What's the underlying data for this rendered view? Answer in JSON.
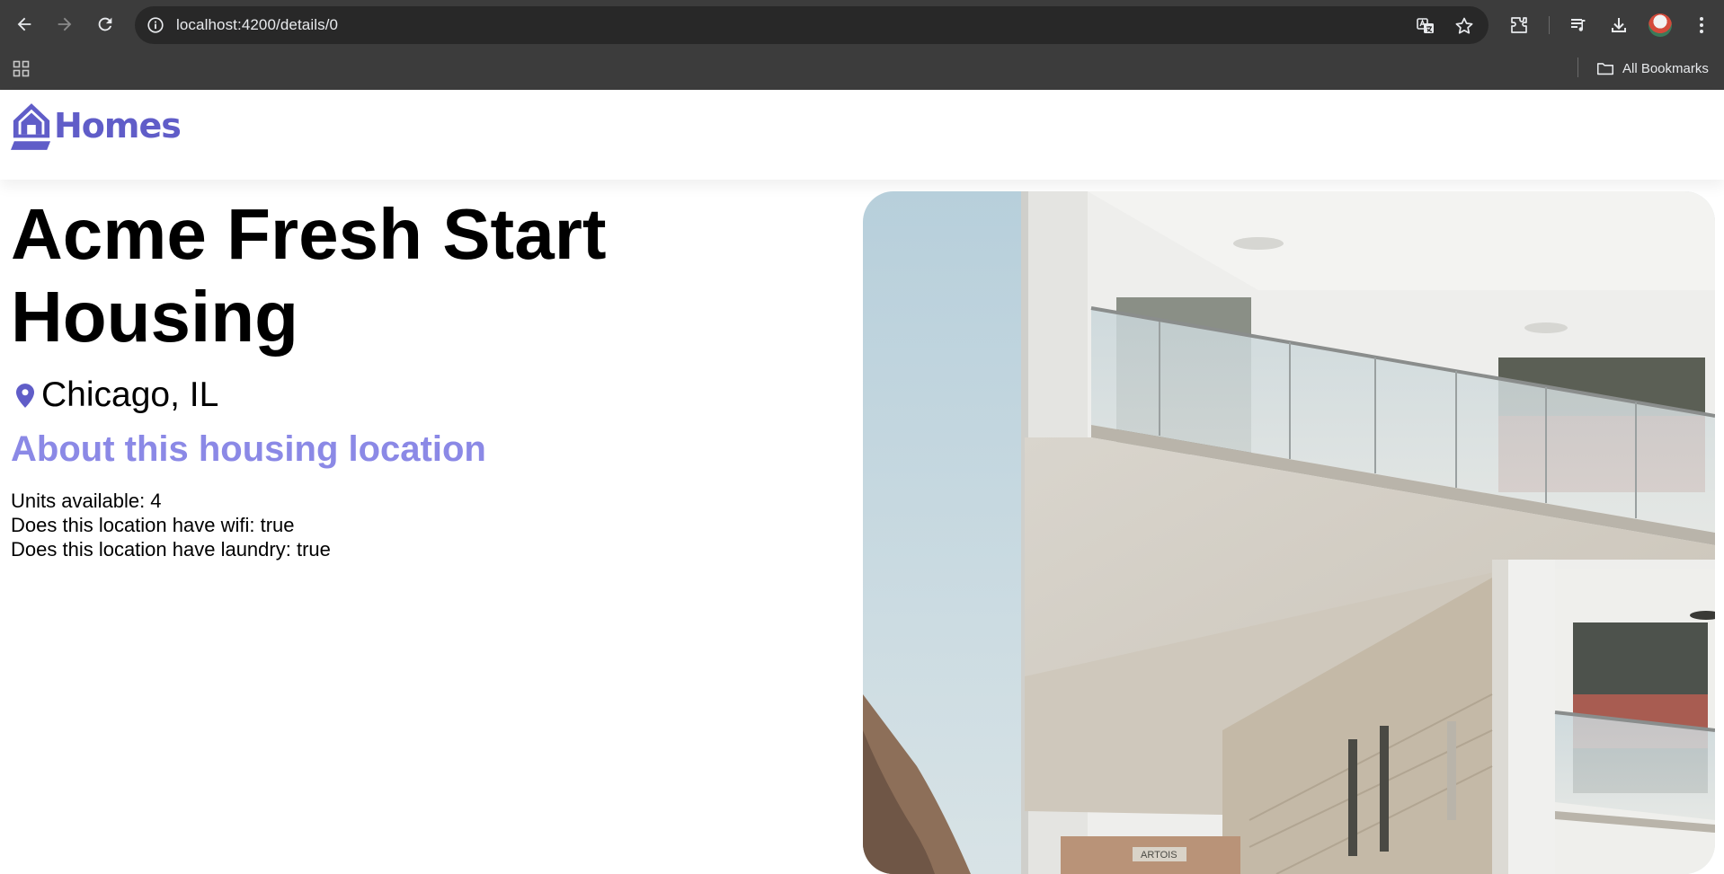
{
  "browser": {
    "url": "localhost:4200/details/0",
    "bookmarks_label": "All Bookmarks"
  },
  "app": {
    "brand": "Homes",
    "brand_color": "#605dc8"
  },
  "listing": {
    "name": "Acme Fresh Start Housing",
    "location": "Chicago, IL",
    "about_heading": "About this housing location",
    "about_color": "#8b89e6",
    "facts": [
      "Units available: 4",
      "Does this location have wifi: true",
      "Does this location have laundry: true"
    ]
  },
  "photo": {
    "sign_text": "ARTOIS"
  }
}
